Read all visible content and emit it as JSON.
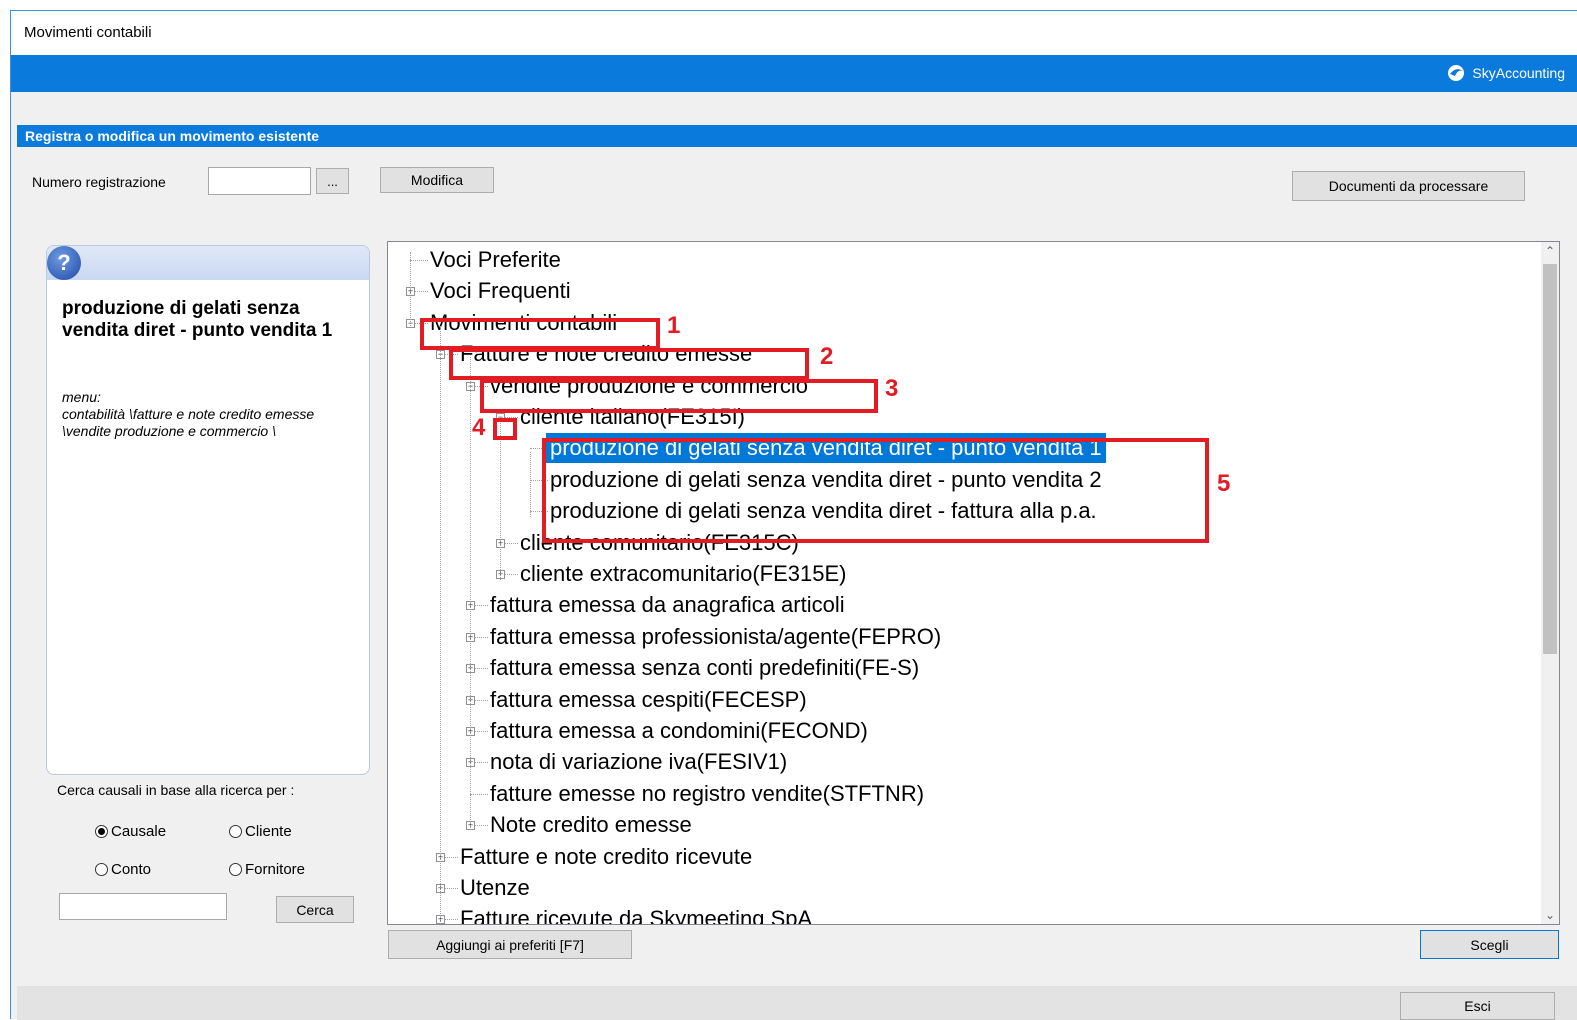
{
  "window": {
    "title": "Movimenti contabili",
    "brand": "SkyAccounting"
  },
  "section": {
    "title": "Registra o modifica un movimento esistente"
  },
  "toolbar": {
    "numero_label": "Numero registrazione",
    "numero_value": "",
    "browse_label": "...",
    "modifica_label": "Modifica",
    "documenti_label": "Documenti da processare"
  },
  "help": {
    "icon": "question-icon",
    "title": "produzione di gelati senza vendita diret - punto vendita 1",
    "menu": "menu:\ncontabilità \\fatture e note credito emesse \\vendite produzione e commercio \\"
  },
  "search": {
    "label": "Cerca causali in base alla ricerca per :",
    "options": [
      "Causale",
      "Cliente",
      "Conto",
      "Fornitore"
    ],
    "selected": "Causale",
    "input_value": "",
    "button": "Cerca"
  },
  "tree": [
    {
      "label": "Voci Preferite",
      "level": 0,
      "expander": "none"
    },
    {
      "label": "Voci Frequenti",
      "level": 0,
      "expander": "plus"
    },
    {
      "label": "Movimenti contabili",
      "level": 0,
      "expander": "minus"
    },
    {
      "label": "Fatture e note credito emesse",
      "level": 1,
      "expander": "minus"
    },
    {
      "label": "vendite produzione e commercio",
      "level": 2,
      "expander": "minus"
    },
    {
      "label": "cliente italiano(FE315I)",
      "level": 3,
      "expander": "minus"
    },
    {
      "label": "produzione di gelati senza vendita diret - punto vendita 1",
      "level": 4,
      "expander": "none",
      "selected": true
    },
    {
      "label": "produzione di gelati senza vendita diret - punto vendita 2",
      "level": 4,
      "expander": "none"
    },
    {
      "label": "produzione di gelati senza vendita diret - fattura alla p.a.",
      "level": 4,
      "expander": "none"
    },
    {
      "label": "cliente comunitario(FE315C)",
      "level": 3,
      "expander": "plus"
    },
    {
      "label": "cliente extracomunitario(FE315E)",
      "level": 3,
      "expander": "plus"
    },
    {
      "label": "fattura emessa da anagrafica articoli",
      "level": 2,
      "expander": "plus"
    },
    {
      "label": "fattura emessa professionista/agente(FEPRO)",
      "level": 2,
      "expander": "plus"
    },
    {
      "label": "fattura emessa senza conti predefiniti(FE-S)",
      "level": 2,
      "expander": "plus"
    },
    {
      "label": "fattura emessa cespiti(FECESP)",
      "level": 2,
      "expander": "plus"
    },
    {
      "label": "fattura emessa a condomini(FECOND)",
      "level": 2,
      "expander": "plus"
    },
    {
      "label": "nota di variazione iva(FESIV1)",
      "level": 2,
      "expander": "plus"
    },
    {
      "label": "fatture emesse no registro vendite(STFTNR)",
      "level": 2,
      "expander": "none"
    },
    {
      "label": "Note credito emesse",
      "level": 2,
      "expander": "plus"
    },
    {
      "label": "Fatture e note credito ricevute",
      "level": 1,
      "expander": "plus"
    },
    {
      "label": "Utenze",
      "level": 1,
      "expander": "plus"
    },
    {
      "label": "Fatture ricevute da Skymeeting SpA",
      "level": 1,
      "expander": "plus"
    }
  ],
  "annotations": [
    "1",
    "2",
    "3",
    "4",
    "5"
  ],
  "buttons": {
    "add_fav": "Aggiungi ai preferiti [F7]",
    "scegli": "Scegli",
    "esci": "Esci"
  },
  "colors": {
    "accent": "#0a7bdc",
    "highlight": "#e31b23",
    "selection": "#0078d7"
  }
}
